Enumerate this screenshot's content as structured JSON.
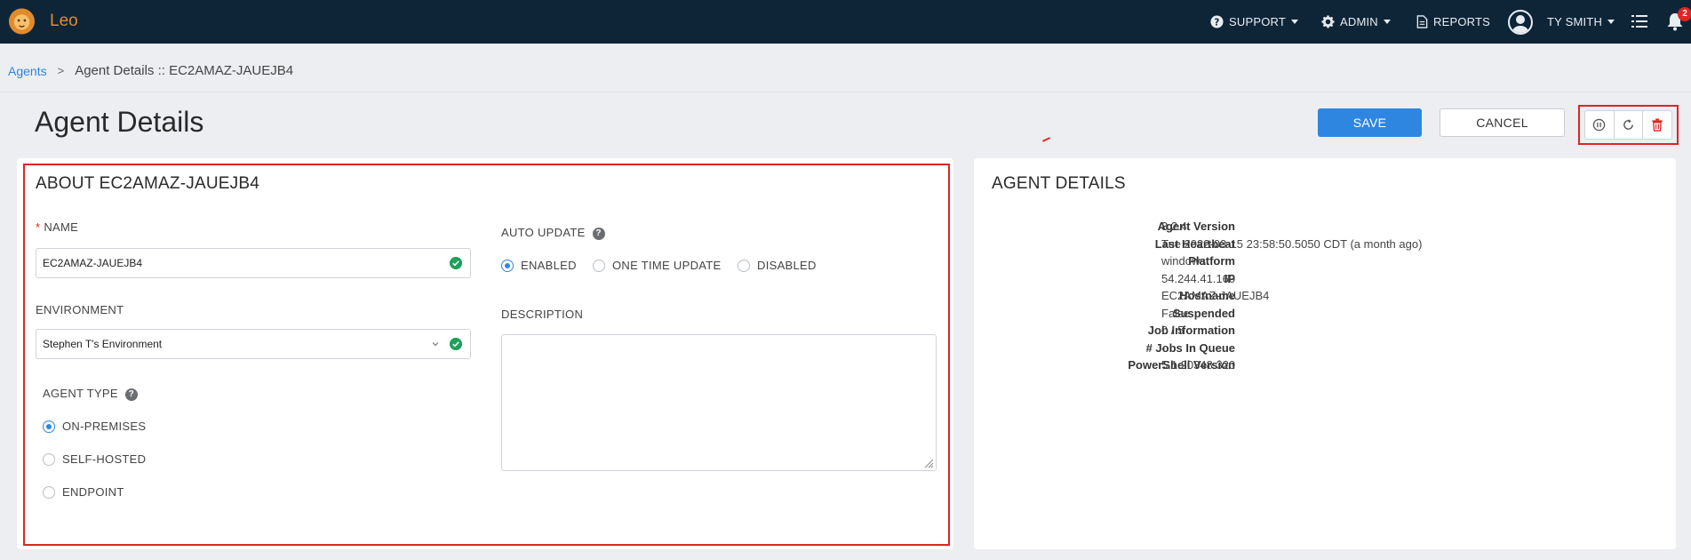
{
  "app": {
    "brand": "Leo"
  },
  "nav": {
    "support": "SUPPORT",
    "admin": "ADMIN",
    "reports": "REPORTS",
    "user": "TY SMITH",
    "notification_count": "2"
  },
  "breadcrumb": {
    "root": "Agents",
    "separator": ">",
    "current": "Agent Details :: EC2AMAZ-JAUEJB4"
  },
  "page": {
    "title": "Agent Details",
    "save_label": "SAVE",
    "cancel_label": "CANCEL"
  },
  "about": {
    "title": "ABOUT EC2AMAZ-JAUEJB4",
    "name_label": "NAME",
    "name_value": "EC2AMAZ-JAUEJB4",
    "environment_label": "ENVIRONMENT",
    "environment_value": "Stephen T's Environment",
    "agent_type_label": "AGENT TYPE",
    "agent_type_options": [
      "ON-PREMISES",
      "SELF-HOSTED",
      "ENDPOINT"
    ],
    "agent_type_selected": "ON-PREMISES",
    "auto_update_label": "AUTO UPDATE",
    "auto_update_options": [
      "ENABLED",
      "ONE TIME UPDATE",
      "DISABLED"
    ],
    "auto_update_selected": "ENABLED",
    "description_label": "DESCRIPTION",
    "description_value": ""
  },
  "details": {
    "title": "AGENT DETAILS",
    "rows": [
      {
        "key": "Agent Version",
        "value": "3.2.4"
      },
      {
        "key": "Last Heartbeat",
        "value": "Tue 2022-03-15 23:58:50.5050 CDT (a month ago)"
      },
      {
        "key": "Platform",
        "value": "windows"
      },
      {
        "key": "IP",
        "value": "54.244.41.160"
      },
      {
        "key": "Hostname",
        "value": "EC2AMAZ-JAUEJB4"
      },
      {
        "key": "Suspended",
        "value": "False"
      },
      {
        "key": "Job Information",
        "value": "0 / 5"
      },
      {
        "key": "# Jobs In Queue",
        "value": "-"
      },
      {
        "key": "PowerShell Version",
        "value": "5.1.20348.320"
      }
    ]
  },
  "colors": {
    "nav_bg": "#0e2538",
    "brand": "#e08b2e",
    "primary": "#2e86e0",
    "danger": "#e02424",
    "success": "#1ea05a"
  },
  "icons": [
    "lion-logo-icon",
    "question-circle-icon",
    "gear-icon",
    "document-icon",
    "user-avatar-icon",
    "list-icon",
    "bell-icon",
    "pause-icon",
    "refresh-icon",
    "trash-icon",
    "check-circle-icon",
    "chevron-down-icon",
    "help-icon"
  ]
}
